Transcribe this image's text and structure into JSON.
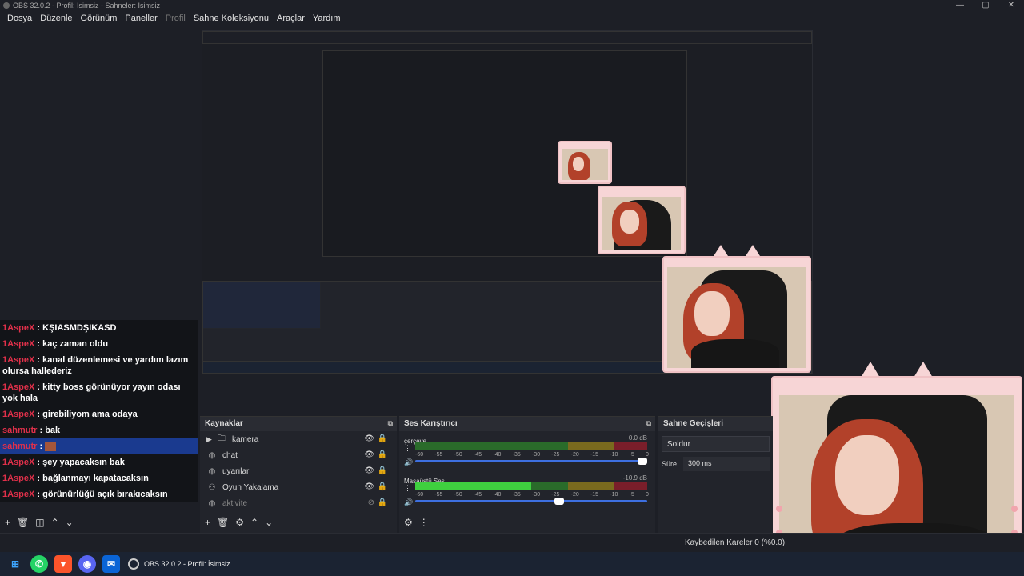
{
  "window": {
    "title": "OBS 32.0.2 - Profil: İsimsiz - Sahneler: İsimsiz",
    "min": "—",
    "max": "▢",
    "close": "✕"
  },
  "menu": [
    "Dosya",
    "Düzenle",
    "Görünüm",
    "Paneller",
    "Profil",
    "Sahne Koleksiyonu",
    "Araçlar",
    "Yardım"
  ],
  "chat": [
    {
      "user": "1AspeX",
      "msg": "KŞIASMDŞIKASD"
    },
    {
      "user": "1AspeX",
      "msg": "kaç zaman oldu"
    },
    {
      "user": "1AspeX",
      "msg": "kanal düzenlemesi ve yardım lazım olursa hallederiz"
    },
    {
      "user": "1AspeX",
      "msg": "kitty boss görünüyor yayın odası yok hala"
    },
    {
      "user": "1AspeX",
      "msg": "girebiliyom ama odaya"
    },
    {
      "user": "sahmutr",
      "msg": "bak"
    },
    {
      "user": "sahmutr",
      "msg": ""
    },
    {
      "user": "1AspeX",
      "msg": "şey yapacaksın bak"
    },
    {
      "user": "1AspeX",
      "msg": "bağlanmayı kapatacaksın"
    },
    {
      "user": "1AspeX",
      "msg": "görünürlüğü açık bırakıcaksın"
    }
  ],
  "sources": {
    "title": "Kaynaklar",
    "items": [
      {
        "name": "kamera",
        "icon": "folder-icon"
      },
      {
        "name": "chat",
        "icon": "browser-icon"
      },
      {
        "name": "uyarılar",
        "icon": "browser-icon"
      },
      {
        "name": "Oyun Yakalama",
        "icon": "gamepad-icon"
      },
      {
        "name": "aktivite",
        "icon": "browser-icon"
      }
    ]
  },
  "mixer": {
    "title": "Ses Karıştırıcı",
    "channels": [
      {
        "name": "çerçeve",
        "db": "0.0 dB",
        "level": 0.0,
        "volume": 0.98
      },
      {
        "name": "Masaüstü Ses",
        "db": "-10.9 dB",
        "level": 0.5,
        "volume": 0.62
      }
    ],
    "ticks": [
      "-60",
      "-55",
      "-50",
      "-45",
      "-40",
      "-35",
      "-30",
      "-25",
      "-20",
      "-15",
      "-10",
      "-5",
      "0"
    ]
  },
  "transitions": {
    "title": "Sahne Geçişleri",
    "selected": "Soldur",
    "duration_label": "Süre",
    "duration": "300 ms"
  },
  "status": {
    "dropped": "Kaybedilen Kareler 0 (%0.0)"
  },
  "taskbar": {
    "obs_label": "OBS 32.0.2 - Profil: İsimsiz"
  }
}
